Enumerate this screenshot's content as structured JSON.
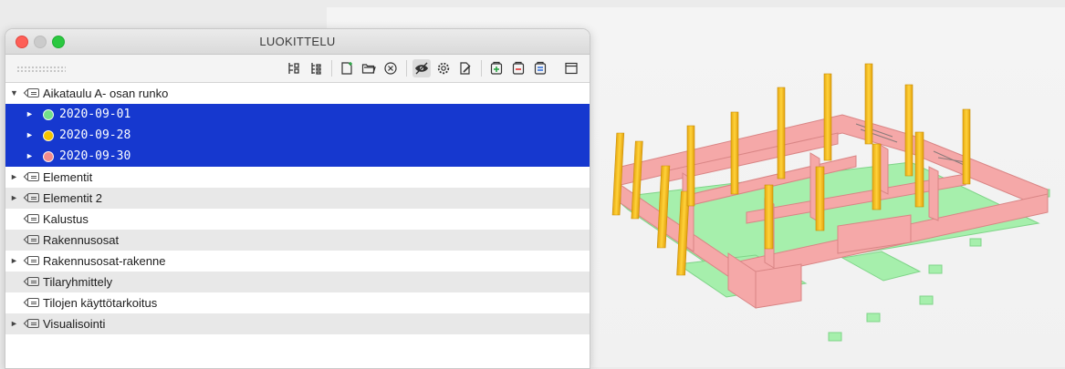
{
  "window": {
    "title": "LUOKITTELU"
  },
  "toolbar": {
    "buttons": [
      {
        "name": "hierarchy-view-icon",
        "active": false
      },
      {
        "name": "list-view-icon",
        "active": false
      },
      {
        "name": "new-document-icon",
        "active": false
      },
      {
        "name": "open-folder-icon",
        "active": false
      },
      {
        "name": "close-circle-icon",
        "active": false
      },
      {
        "name": "visibility-icon",
        "active": true
      },
      {
        "name": "settings-gear-icon",
        "active": false
      },
      {
        "name": "edit-document-icon",
        "active": false
      },
      {
        "name": "add-item-icon",
        "active": false
      },
      {
        "name": "remove-item-icon",
        "active": false
      },
      {
        "name": "edit-item-icon",
        "active": false
      },
      {
        "name": "window-layout-icon",
        "active": false
      }
    ]
  },
  "tree": {
    "items": [
      {
        "label": "Aikataulu A- osan runko",
        "expanded": true,
        "has_children": true,
        "level": 0
      },
      {
        "label": "2020-09-01",
        "level": 1,
        "dot_color": "#73e08a",
        "selected": true
      },
      {
        "label": "2020-09-28",
        "level": 1,
        "dot_color": "#f5c400",
        "selected": true
      },
      {
        "label": "2020-09-30",
        "level": 1,
        "dot_color": "#f28c8c",
        "selected": true
      },
      {
        "label": "Elementit",
        "has_children": true,
        "level": 0
      },
      {
        "label": "Elementit 2",
        "has_children": true,
        "level": 0
      },
      {
        "label": "Kalustus",
        "has_children": false,
        "level": 0
      },
      {
        "label": "Rakennusosat",
        "has_children": false,
        "level": 0
      },
      {
        "label": "Rakennusosat-rakenne",
        "has_children": true,
        "level": 0
      },
      {
        "label": "Tilaryhmittely",
        "has_children": false,
        "level": 0
      },
      {
        "label": "Tilojen käyttötarkoitus",
        "has_children": false,
        "level": 0
      },
      {
        "label": "Visualisointi",
        "has_children": true,
        "level": 0
      }
    ]
  },
  "colors": {
    "selection": "#1638cf",
    "walls": "#f4a3a3",
    "slabs": "#9ff0a6",
    "columns": "#f6c21b"
  }
}
